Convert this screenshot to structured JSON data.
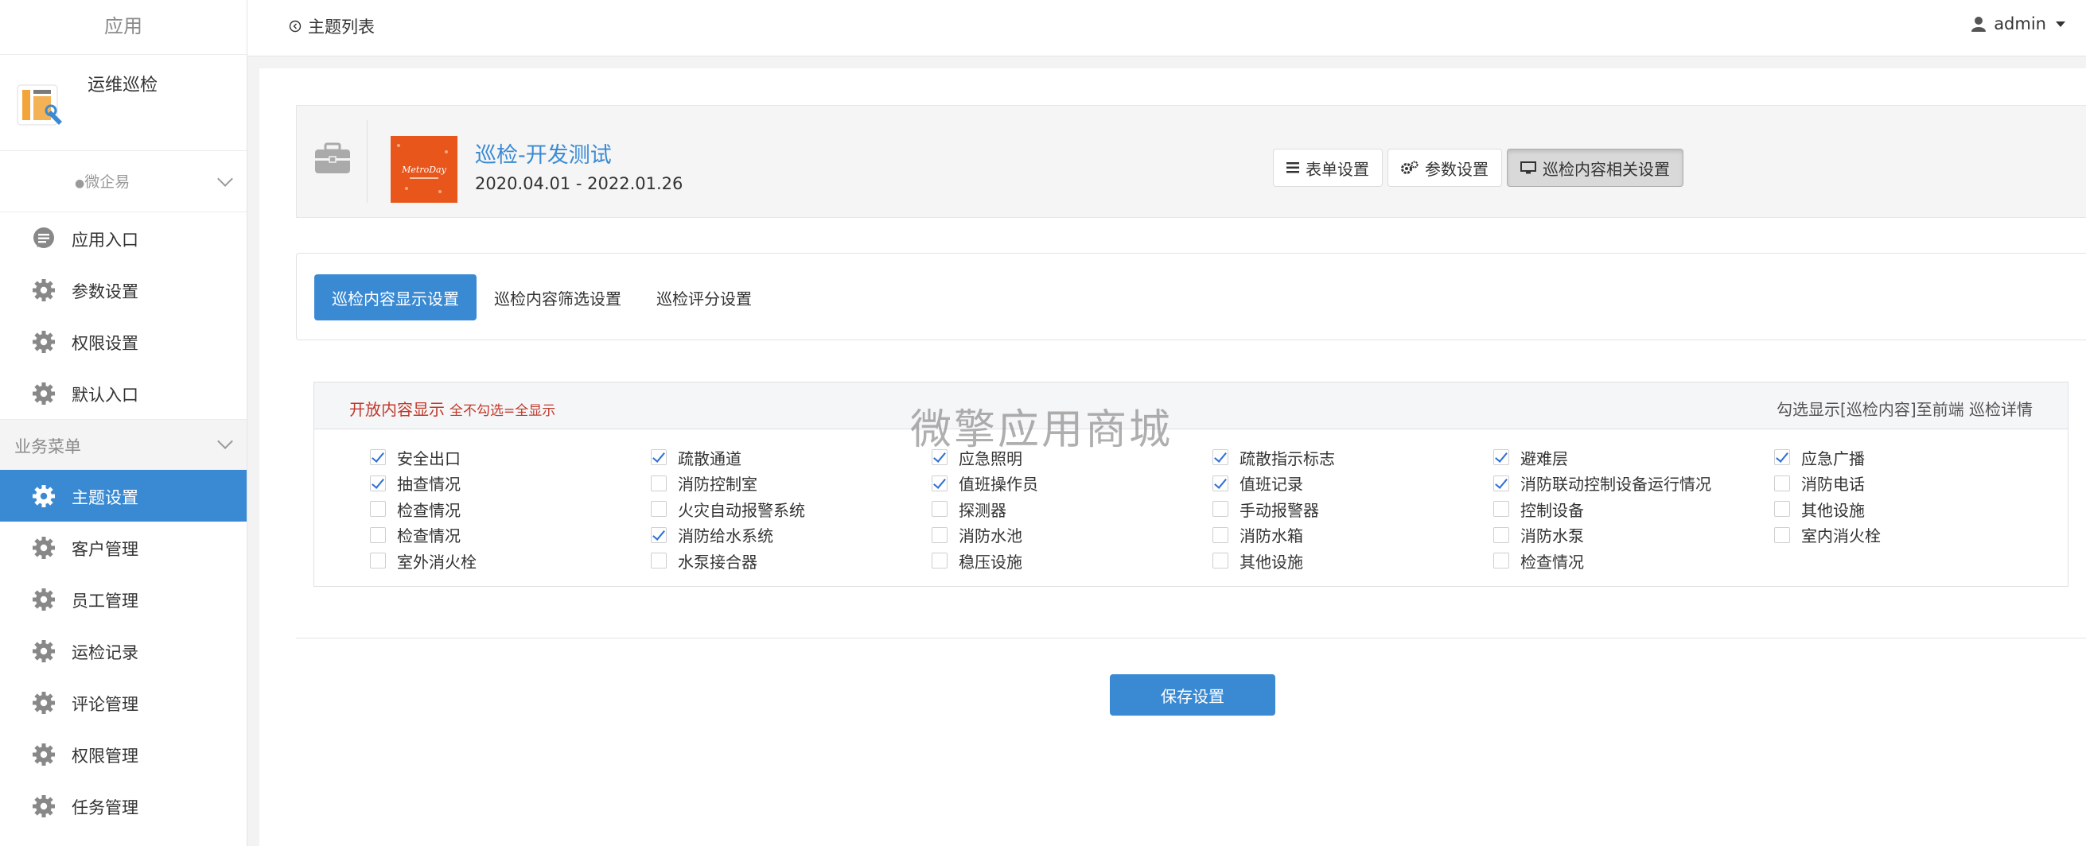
{
  "sidebar": {
    "title": "应用",
    "app_name": "运维巡检",
    "group_label": "微企易",
    "items_top": [
      {
        "label": "应用入口",
        "icon": "chat-bubble-icon"
      },
      {
        "label": "参数设置",
        "icon": "gear-icon"
      },
      {
        "label": "权限设置",
        "icon": "gear-icon"
      },
      {
        "label": "默认入口",
        "icon": "gear-icon"
      }
    ],
    "section_label": "业务菜单",
    "items_business": [
      {
        "label": "主题设置",
        "icon": "gear-icon",
        "active": true
      },
      {
        "label": "客户管理",
        "icon": "gear-icon"
      },
      {
        "label": "员工管理",
        "icon": "gear-icon"
      },
      {
        "label": "运检记录",
        "icon": "gear-icon"
      },
      {
        "label": "评论管理",
        "icon": "gear-icon"
      },
      {
        "label": "权限管理",
        "icon": "gear-icon"
      },
      {
        "label": "任务管理",
        "icon": "gear-icon"
      }
    ]
  },
  "topbar": {
    "back_label": "主题列表",
    "user": "admin"
  },
  "topic": {
    "title": "巡检-开发测试",
    "date_range": "2020.04.01 - 2022.01.26",
    "thumb_text": "MetroDay",
    "buttons": [
      {
        "label": "表单设置",
        "icon": "list-icon"
      },
      {
        "label": "参数设置",
        "icon": "gears-icon"
      },
      {
        "label": "巡检内容相关设置",
        "icon": "monitor-icon",
        "active": true
      }
    ]
  },
  "tabs": [
    {
      "label": "巡检内容显示设置",
      "active": true
    },
    {
      "label": "巡检内容筛选设置"
    },
    {
      "label": "巡检评分设置"
    }
  ],
  "config": {
    "head_left": "开放内容显示",
    "head_hint": "全不勾选=全显示",
    "head_right": "勾选显示[巡检内容]至前端 巡检详情",
    "watermark": "微擎应用商城",
    "items": [
      {
        "label": "安全出口",
        "checked": true
      },
      {
        "label": "疏散通道",
        "checked": true
      },
      {
        "label": "应急照明",
        "checked": true
      },
      {
        "label": "疏散指示标志",
        "checked": true
      },
      {
        "label": "避难层",
        "checked": true
      },
      {
        "label": "应急广播",
        "checked": true
      },
      {
        "label": "抽查情况",
        "checked": true
      },
      {
        "label": "消防控制室",
        "checked": false
      },
      {
        "label": "值班操作员",
        "checked": true
      },
      {
        "label": "值班记录",
        "checked": true
      },
      {
        "label": "消防联动控制设备运行情况",
        "checked": true
      },
      {
        "label": "消防电话",
        "checked": false
      },
      {
        "label": "检查情况",
        "checked": false
      },
      {
        "label": "火灾自动报警系统",
        "checked": false
      },
      {
        "label": "探测器",
        "checked": false
      },
      {
        "label": "手动报警器",
        "checked": false
      },
      {
        "label": "控制设备",
        "checked": false
      },
      {
        "label": "其他设施",
        "checked": false
      },
      {
        "label": "检查情况",
        "checked": false
      },
      {
        "label": "消防给水系统",
        "checked": true
      },
      {
        "label": "消防水池",
        "checked": false
      },
      {
        "label": "消防水箱",
        "checked": false
      },
      {
        "label": "消防水泵",
        "checked": false
      },
      {
        "label": "室内消火栓",
        "checked": false
      },
      {
        "label": "室外消火栓",
        "checked": false
      },
      {
        "label": "水泵接合器",
        "checked": false
      },
      {
        "label": "稳压设施",
        "checked": false
      },
      {
        "label": "其他设施",
        "checked": false
      },
      {
        "label": "检查情况",
        "checked": false
      }
    ],
    "save_label": "保存设置"
  },
  "colors": {
    "accent": "#3a8ad3",
    "hint_red": "#c0392b",
    "thumb_orange": "#e8561c"
  }
}
